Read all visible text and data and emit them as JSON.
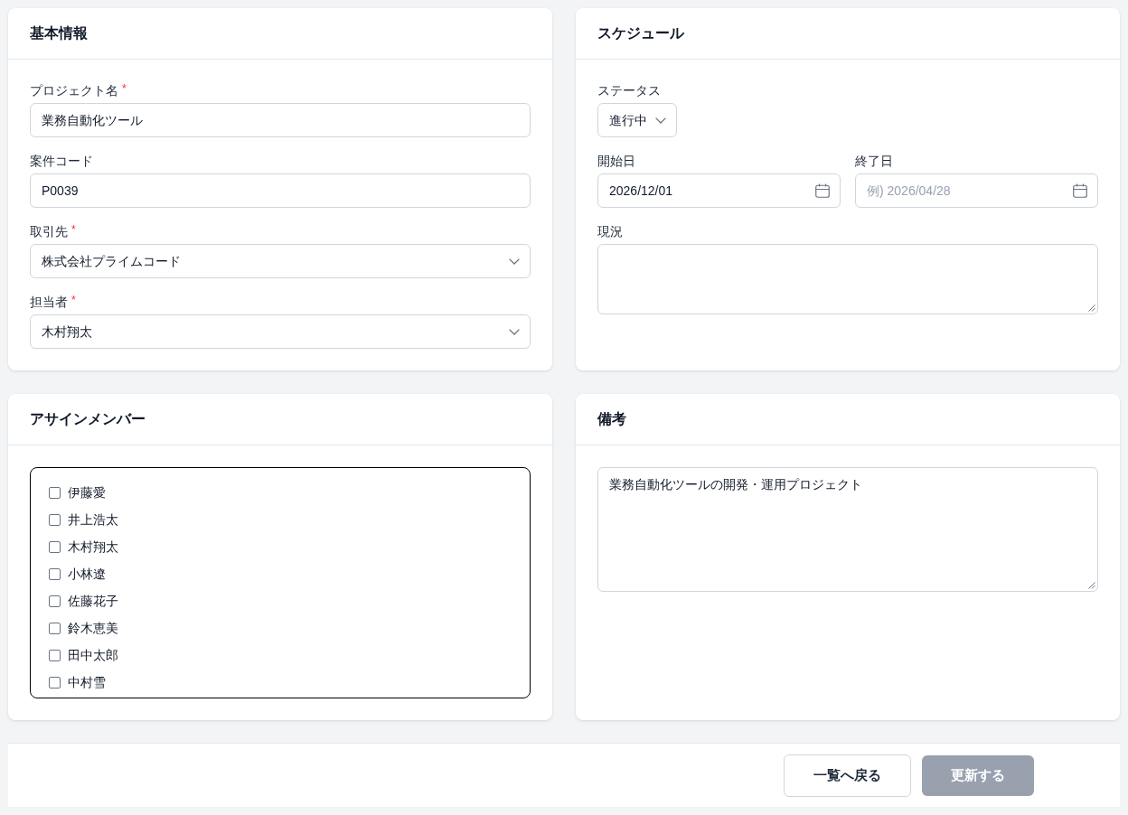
{
  "basic_info": {
    "title": "基本情報",
    "fields": [
      {
        "kind": "text",
        "label": "プロジェクト名",
        "required_mark": "*",
        "value": "業務自動化ツール"
      },
      {
        "kind": "text",
        "label": "案件コード",
        "value": "P0039"
      },
      {
        "kind": "select",
        "label": "取引先",
        "required_mark": "*",
        "value": "株式会社プライムコード"
      },
      {
        "kind": "select",
        "label": "担当者",
        "required_mark": "*",
        "value": "木村翔太"
      }
    ]
  },
  "schedule": {
    "title": "スケジュール",
    "status": {
      "label": "ステータス",
      "value": "進行中"
    },
    "start_date": {
      "label": "開始日",
      "value": "2026/12/01"
    },
    "end_date": {
      "label": "終了日",
      "placeholder": "例) 2026/04/28"
    },
    "current_state": {
      "label": "現況"
    }
  },
  "members": {
    "title": "アサインメンバー",
    "items": [
      {
        "name": "伊藤愛",
        "checked": false
      },
      {
        "name": "井上浩太",
        "checked": false
      },
      {
        "name": "木村翔太",
        "checked": false
      },
      {
        "name": "小林遼",
        "checked": false
      },
      {
        "name": "佐藤花子",
        "checked": false
      },
      {
        "name": "鈴木恵美",
        "checked": false
      },
      {
        "name": "田中太郎",
        "checked": false
      },
      {
        "name": "中村雪",
        "checked": false
      }
    ]
  },
  "notes": {
    "title": "備考",
    "value": "業務自動化ツールの開発・運用プロジェクト"
  },
  "footer": {
    "buttons": [
      {
        "kind": "back",
        "label": "一覧へ戻る",
        "disabled": false
      },
      {
        "kind": "submit",
        "label": "更新する",
        "disabled": true
      }
    ]
  }
}
